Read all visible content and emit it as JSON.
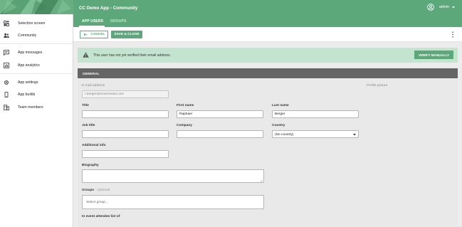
{
  "app": {
    "title": "CC Demo App - Community",
    "user": "admin"
  },
  "sidebar": {
    "items": [
      {
        "label": "Selection screen",
        "icon": "selection-screen-icon"
      },
      {
        "label": "Community",
        "icon": "community-icon"
      },
      {
        "label": "App messages",
        "icon": "messages-icon"
      },
      {
        "label": "App analytics",
        "icon": "analytics-icon"
      },
      {
        "label": "App settings",
        "icon": "gear-icon"
      },
      {
        "label": "App builds",
        "icon": "phone-icon"
      },
      {
        "label": "Team members",
        "icon": "team-icon"
      }
    ]
  },
  "tabs": [
    {
      "label": "APP USERS",
      "active": true
    },
    {
      "label": "GROUPS",
      "active": false
    }
  ],
  "toolbar": {
    "cancel_label": "CANCEL",
    "save_label": "SAVE & CLOSE"
  },
  "alert": {
    "text": "This user has not yet verified their email address.",
    "button_label": "VERIFY MANUALLY"
  },
  "section": {
    "title": "GENERAL"
  },
  "form": {
    "email": {
      "label": "E-mail address",
      "value": "r.berger@fooiemedia.com"
    },
    "profile_picture": {
      "label": "Profile picture"
    },
    "title": {
      "label": "Title",
      "value": ""
    },
    "first_name": {
      "label": "First name",
      "value": "Raphael"
    },
    "last_name": {
      "label": "Last name",
      "value": "Berger"
    },
    "job_title": {
      "label": "Job title",
      "value": ""
    },
    "company": {
      "label": "Company",
      "value": ""
    },
    "country": {
      "label": "Country",
      "value": "(No country)"
    },
    "additional_info": {
      "label": "Additional info",
      "value": ""
    },
    "biography": {
      "label": "Biography",
      "value": ""
    },
    "groups": {
      "label": "Groups",
      "optional": "· Optional",
      "placeholder": "Select group..."
    },
    "event_attendee": {
      "label": "In event attendee list of"
    }
  },
  "colors": {
    "brand_green": "#5da87a",
    "alert_bg": "#c3e5cf",
    "section_header": "#656565"
  }
}
